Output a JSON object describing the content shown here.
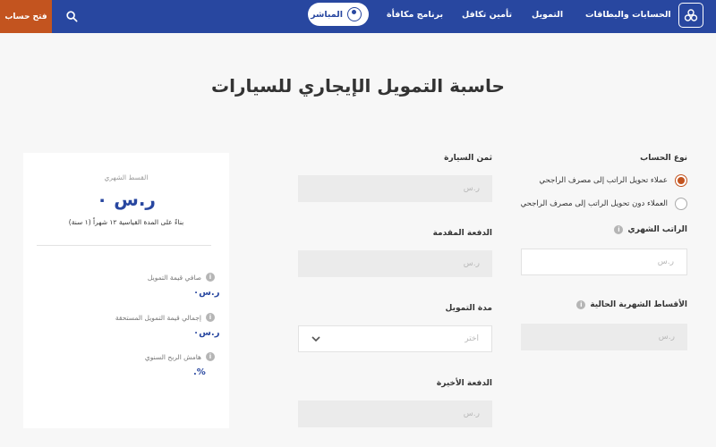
{
  "header": {
    "open_account": "فتح حساب",
    "nav": {
      "accounts_cards": "الحسابات والبطاقات",
      "financing": "التمويل",
      "takaful": "تأمين تكافل",
      "rewards": "برنامج مكافأة",
      "mubasher": "المباشر"
    }
  },
  "page": {
    "title": "حاسبة التمويل الإيجاري للسيارات"
  },
  "form": {
    "account_type_label": "نوع الحساب",
    "account_options": [
      {
        "label": "عملاء تحويل الراتب إلى مصرف الراجحي",
        "selected": true
      },
      {
        "label": "العملاء دون تحويل الراتب إلى مصرف الراجحي",
        "selected": false
      }
    ],
    "monthly_salary_label": "الراتب الشهري",
    "monthly_salary_placeholder": "ر.س",
    "current_installments_label": "الأقساط الشهرية الحالية",
    "current_installments_placeholder": "ر.س",
    "car_price_label": "ثمن السيارة",
    "car_price_placeholder": "ر.س",
    "down_payment_label": "الدفعة المقدمة",
    "down_payment_placeholder": "ر.س",
    "financing_period_label": "مدة التمويل",
    "financing_period_placeholder": "اختر",
    "final_payment_label": "الدفعة الأخيرة",
    "final_payment_placeholder": "ر.س"
  },
  "summary": {
    "caption": "القسط الشهري",
    "amount": "ر.س ٠",
    "note": "بناءً على المدة القياسية ١٢ شهراً (١ سنة)",
    "net_financing_label": "صافي قيمة التمويل",
    "net_financing_value": "ر.س٠",
    "total_financing_label": "إجمالي قيمة التمويل المستحقة",
    "total_financing_value": "ر.س٠",
    "annual_margin_label": "هامش الربح السنوي",
    "annual_margin_value": "%."
  },
  "colors": {
    "brand_blue": "#2847a0",
    "accent_orange": "#c3541f",
    "page_background": "#f7f7f7"
  }
}
